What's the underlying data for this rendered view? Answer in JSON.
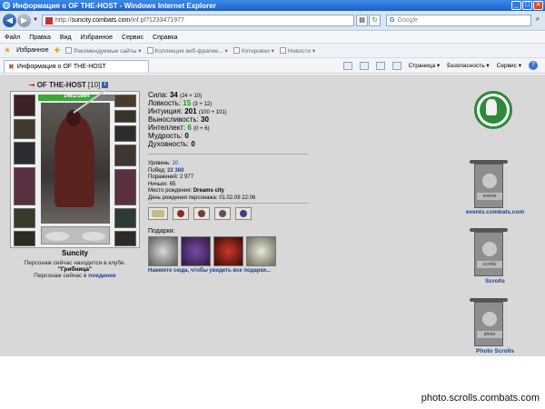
{
  "browser": {
    "window_title": "Информация о OF THE-HOST - Windows Internet Explorer",
    "url_prefix": "http://",
    "url_host": "suncity.combats.com",
    "url_path": "/inf.pl?1233471977",
    "search_placeholder": "Google",
    "menu": [
      "Файл",
      "Правка",
      "Вид",
      "Избранное",
      "Сервис",
      "Справка"
    ],
    "favorites_label": "Избранное",
    "favorites_items": [
      "Рекомендуемые сайты ▾",
      "Коллекция веб-фрагме... ▾",
      "Котировки ▾",
      "Новости ▾"
    ],
    "tab_title": "Информация о OF THE-HOST",
    "cmd": {
      "page": "Страница ▾",
      "security": "Безопасность ▾",
      "service": "Сервис ▾"
    }
  },
  "character": {
    "name": "OF THE-HOST",
    "level": "[10]",
    "info_icon": "i",
    "hp": "1461/1984",
    "hp_fraction": 0.736,
    "stats": {
      "strength_label": "Сила:",
      "strength_value": "34",
      "strength_detail": "(24 + 10)",
      "agility_label": "Ловкость:",
      "agility_value": "15",
      "agility_detail": "(3 + 12)",
      "intuition_label": "Интуиция:",
      "intuition_value": "201",
      "intuition_detail": "(100 + 101)",
      "endurance_label": "Выносливость:",
      "endurance_value": "30",
      "intellect_label": "Интеллект:",
      "intellect_value": "6",
      "intellect_detail": "(0 + 6)",
      "wisdom_label": "Мудрость:",
      "wisdom_value": "0",
      "spirit_label": "Духовность:",
      "spirit_value": "0"
    },
    "info": {
      "level_label": "Уровень:",
      "level_value": "10",
      "wins_label": "Побед:",
      "wins_value": "22 360",
      "losses_label": "Поражений:",
      "losses_value": "2 977",
      "draws_label": "Ничьих:",
      "draws_value": "65",
      "birthplace_label": "Место рождения:",
      "birthplace_value": "Dreams city",
      "birthday_label": "День рождения персонажа:",
      "birthday_value": "01.02.09 22:06"
    },
    "guild": "Suncity",
    "club_line": "Персонаж сейчас находится в клубе.",
    "club_name": "\"Грибница\"",
    "place_prefix": "Персонаж сейчас в",
    "place_link": "поединке",
    "gifts_label": "Подарки:",
    "gifts_link": "Нажмите сюда, чтобы увидеть все подарки..."
  },
  "sidebar": {
    "events_caption": "events.combats.com",
    "events_label": "events",
    "scrolls_caption": "Scrolls",
    "scrolls_label": "scrolls",
    "photo_caption": "Photo Scrolls",
    "photo_label": "photo"
  },
  "footer_caption": "photo.scrolls.combats.com",
  "colors": {
    "link_blue": "#1b3f8c",
    "stat_green": "#1a9a1a",
    "hp_green": "#3aa838",
    "banner_green": "#2e8a3a"
  }
}
